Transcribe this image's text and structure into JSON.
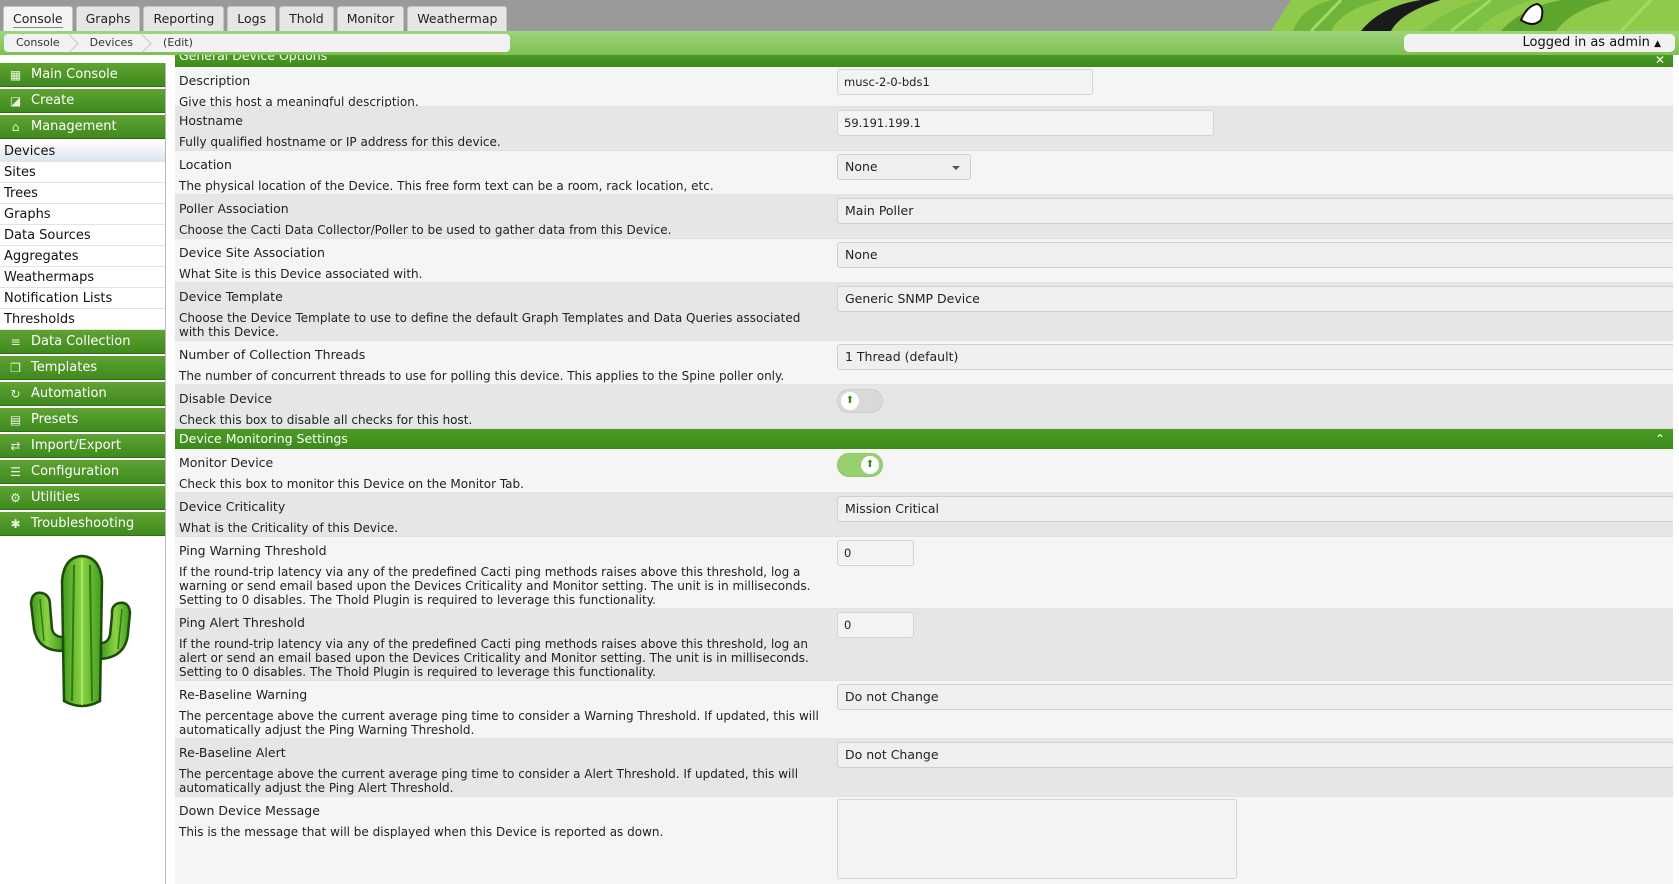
{
  "top_tabs": [
    {
      "label": "Console",
      "active": true
    },
    {
      "label": "Graphs",
      "active": false
    },
    {
      "label": "Reporting",
      "active": false
    },
    {
      "label": "Logs",
      "active": false
    },
    {
      "label": "Thold",
      "active": false
    },
    {
      "label": "Monitor",
      "active": false
    },
    {
      "label": "Weathermap",
      "active": false
    }
  ],
  "breadcrumb": [
    "Console",
    "Devices",
    "(Edit)"
  ],
  "user_status": "Logged in as admin",
  "sidebar": {
    "menus_top": [
      {
        "label": "Main Console",
        "icon": "map-icon"
      },
      {
        "label": "Create",
        "icon": "chart-icon"
      },
      {
        "label": "Management",
        "icon": "home-icon"
      }
    ],
    "management_items": [
      "Devices",
      "Sites",
      "Trees",
      "Graphs",
      "Data Sources",
      "Aggregates",
      "Weathermaps",
      "Notification Lists",
      "Thresholds"
    ],
    "selected_item": "Devices",
    "menus_bottom": [
      {
        "label": "Data Collection",
        "icon": "database-icon"
      },
      {
        "label": "Templates",
        "icon": "copy-icon"
      },
      {
        "label": "Automation",
        "icon": "refresh-icon"
      },
      {
        "label": "Presets",
        "icon": "archive-icon"
      },
      {
        "label": "Import/Export",
        "icon": "exchange-icon"
      },
      {
        "label": "Configuration",
        "icon": "sliders-icon"
      },
      {
        "label": "Utilities",
        "icon": "cogs-icon"
      },
      {
        "label": "Troubleshooting",
        "icon": "bug-icon"
      }
    ]
  },
  "sections": {
    "general": {
      "title": "General Device Options"
    },
    "monitoring": {
      "title": "Device Monitoring Settings"
    }
  },
  "fields": {
    "description": {
      "label": "Description",
      "help": "Give this host a meaningful description.",
      "value": "musc-2-0-bds1"
    },
    "hostname": {
      "label": "Hostname",
      "help": "Fully qualified hostname or IP address for this device.",
      "value": "59.191.199.1"
    },
    "location": {
      "label": "Location",
      "help": "The physical location of the Device. This free form text can be a room, rack location, etc.",
      "value": "None"
    },
    "poller": {
      "label": "Poller Association",
      "help": "Choose the Cacti Data Collector/Poller to be used to gather data from this Device.",
      "value": "Main Poller"
    },
    "site": {
      "label": "Device Site Association",
      "help": "What Site is this Device associated with.",
      "value": "None"
    },
    "template": {
      "label": "Device Template",
      "help": "Choose the Device Template to use to define the default Graph Templates and Data Queries associated with this Device.",
      "value": "Generic SNMP Device"
    },
    "threads": {
      "label": "Number of Collection Threads",
      "help": "The number of concurrent threads to use for polling this device. This applies to the Spine poller only.",
      "value": "1 Thread (default)"
    },
    "disable": {
      "label": "Disable Device",
      "help": "Check this box to disable all checks for this host.",
      "checked": false
    },
    "monitor": {
      "label": "Monitor Device",
      "help": "Check this box to monitor this Device on the Monitor Tab.",
      "checked": true
    },
    "criticality": {
      "label": "Device Criticality",
      "help": "What is the Criticality of this Device.",
      "value": "Mission Critical"
    },
    "ping_warn": {
      "label": "Ping Warning Threshold",
      "help": "If the round-trip latency via any of the predefined Cacti ping methods raises above this threshold, log a warning or send email based upon the Devices Criticality and Monitor setting. The unit is in milliseconds. Setting to 0 disables. The Thold Plugin is required to leverage this functionality.",
      "value": "0"
    },
    "ping_alert": {
      "label": "Ping Alert Threshold",
      "help": "If the round-trip latency via any of the predefined Cacti ping methods raises above this threshold, log an alert or send an email based upon the Devices Criticality and Monitor setting. The unit is in milliseconds. Setting to 0 disables. The Thold Plugin is required to leverage this functionality.",
      "value": "0"
    },
    "rebase_warn": {
      "label": "Re-Baseline Warning",
      "help": "The percentage above the current average ping time to consider a Warning Threshold. If updated, this will automatically adjust the Ping Warning Threshold.",
      "value": "Do not Change"
    },
    "rebase_alert": {
      "label": "Re-Baseline Alert",
      "help": "The percentage above the current average ping time to consider a Alert Threshold. If updated, this will automatically adjust the Ping Alert Threshold.",
      "value": "Do not Change"
    },
    "down_msg": {
      "label": "Down Device Message",
      "help": "This is the message that will be displayed when this Device is reported as down.",
      "value": ""
    }
  },
  "colors": {
    "accent_green": "#4c9a26",
    "nav_green": "#8fca65",
    "toggle_on": "#97d06f"
  }
}
